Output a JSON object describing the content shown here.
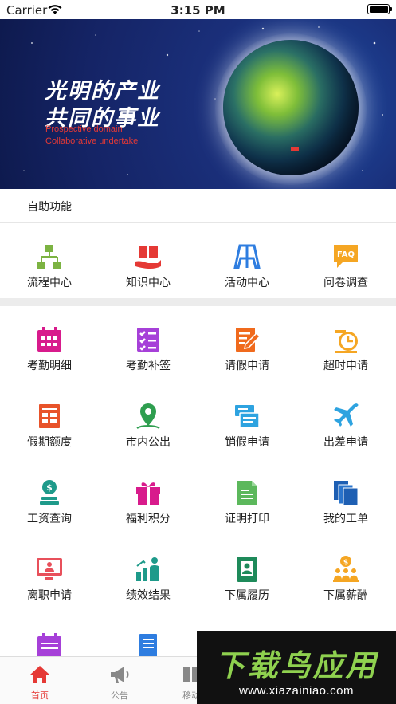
{
  "status_bar": {
    "carrier": "Carrier",
    "time": "3:15 PM"
  },
  "banner": {
    "slogan_line1": "光明的产业",
    "slogan_line2": "共同的事业",
    "english_line1": "Prospective domain",
    "english_line2": "Collaborative undertake"
  },
  "section": {
    "title": "自助功能"
  },
  "top_grid": [
    {
      "label": "流程中心",
      "icon": "org-chart-icon",
      "color": "#7cb342"
    },
    {
      "label": "知识中心",
      "icon": "book-hand-icon",
      "color": "#e53935"
    },
    {
      "label": "活动中心",
      "icon": "easel-icon",
      "color": "#2e7de0"
    },
    {
      "label": "问卷调查",
      "icon": "faq-bubble-icon",
      "color": "#f5a623"
    }
  ],
  "main_grid": [
    {
      "label": "考勤明细",
      "icon": "calendar-icon",
      "color": "#d81b8c"
    },
    {
      "label": "考勤补签",
      "icon": "checklist-icon",
      "color": "#a640d8"
    },
    {
      "label": "请假申请",
      "icon": "edit-doc-icon",
      "color": "#f06a1d"
    },
    {
      "label": "超时申请",
      "icon": "clock-icon",
      "color": "#f5a623"
    },
    {
      "label": "假期额度",
      "icon": "ledger-icon",
      "color": "#e8532a"
    },
    {
      "label": "市内公出",
      "icon": "location-pin-icon",
      "color": "#2e9e4f"
    },
    {
      "label": "销假申请",
      "icon": "forms-icon",
      "color": "#2ea3e0"
    },
    {
      "label": "出差申请",
      "icon": "airplane-icon",
      "color": "#2ea3e0"
    },
    {
      "label": "工资查询",
      "icon": "coin-stack-icon",
      "color": "#1e9a8a"
    },
    {
      "label": "福利积分",
      "icon": "gift-icon",
      "color": "#d81b8c"
    },
    {
      "label": "证明打印",
      "icon": "certificate-icon",
      "color": "#5cb85c"
    },
    {
      "label": "我的工单",
      "icon": "documents-icon",
      "color": "#1e5fb3"
    },
    {
      "label": "离职申请",
      "icon": "monitor-person-icon",
      "color": "#e8505b"
    },
    {
      "label": "绩效结果",
      "icon": "growth-person-icon",
      "color": "#1e9a8a"
    },
    {
      "label": "下属履历",
      "icon": "profile-card-icon",
      "color": "#1e8a5a"
    },
    {
      "label": "下属薪酬",
      "icon": "team-money-icon",
      "color": "#f5a623"
    },
    {
      "label": "",
      "icon": "calendar-partial-icon",
      "color": "#a640d8"
    },
    {
      "label": "",
      "icon": "notebook-partial-icon",
      "color": "#2e7de0"
    }
  ],
  "tabbar": [
    {
      "label": "首页",
      "icon": "home-icon",
      "active": true
    },
    {
      "label": "公告",
      "icon": "megaphone-icon",
      "active": false
    },
    {
      "label": "移动",
      "icon": "book-icon",
      "active": false
    }
  ],
  "watermark": {
    "title": "下载鸟应用",
    "url": "www.xiazainiao.com"
  },
  "colors": {
    "accent": "#e53935",
    "banner_bg": "#152466",
    "divider": "#ececec"
  }
}
